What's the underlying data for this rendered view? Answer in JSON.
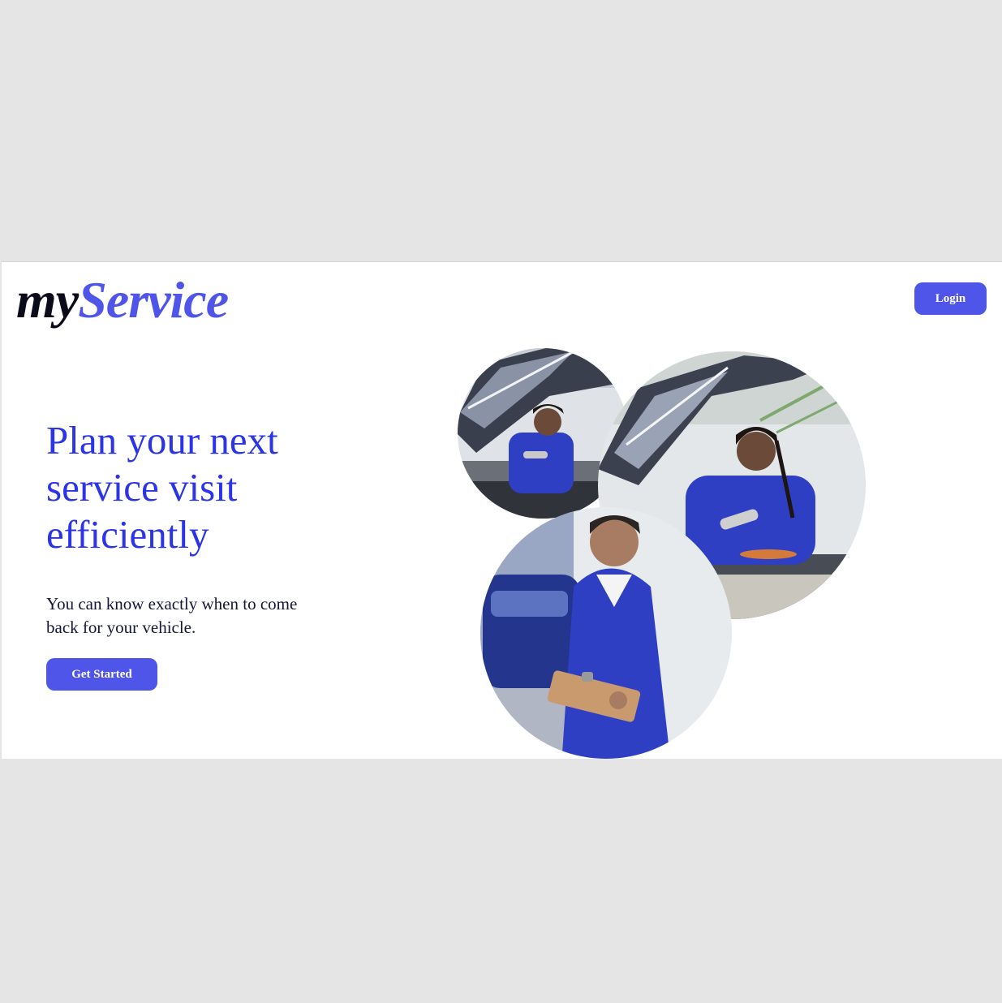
{
  "header": {
    "logo_part1": "my",
    "logo_part2": "Service",
    "login_label": "Login"
  },
  "hero": {
    "headline": "Plan your next service visit efficiently",
    "subtext": "You can know exactly when to come back for your vehicle.",
    "cta_label": "Get Started"
  },
  "photos": [
    {
      "name": "mechanic-inspecting-engine-photo"
    },
    {
      "name": "mechanic-with-flashlight-photo"
    },
    {
      "name": "mechanic-with-clipboard-photo"
    }
  ],
  "colors": {
    "accent": "#4f55e8",
    "headline": "#2b34e6",
    "page_background": "#e5e5e5",
    "uniform_blue": "#2f3fc4"
  }
}
